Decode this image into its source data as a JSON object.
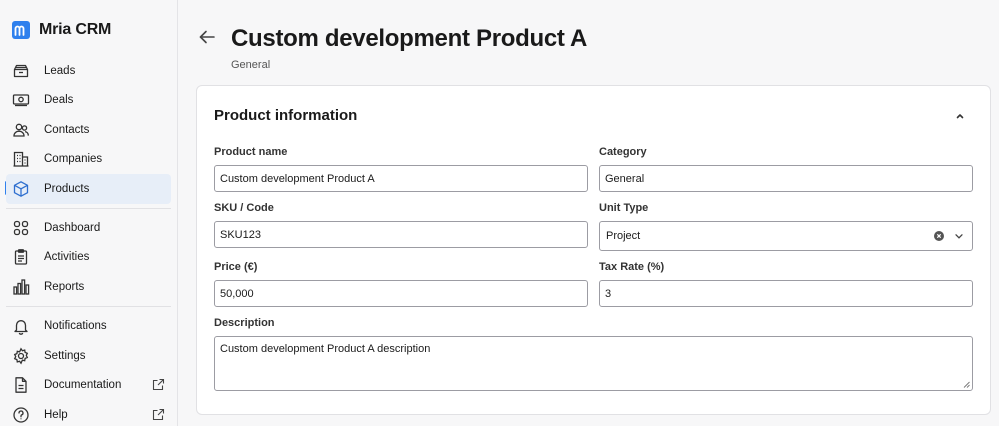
{
  "brand": {
    "name": "Mria CRM",
    "logo_letter": "m",
    "accent": "#2f80ed"
  },
  "sidebar": {
    "items": [
      {
        "label": "Leads",
        "icon": "tray-icon"
      },
      {
        "label": "Deals",
        "icon": "banknote-icon"
      },
      {
        "label": "Contacts",
        "icon": "people-icon"
      },
      {
        "label": "Companies",
        "icon": "building-icon"
      },
      {
        "label": "Products",
        "icon": "cube-icon",
        "active": true
      },
      {
        "label": "Dashboard",
        "icon": "grid-icon"
      },
      {
        "label": "Activities",
        "icon": "clipboard-icon"
      },
      {
        "label": "Reports",
        "icon": "bar-chart-icon"
      },
      {
        "label": "Notifications",
        "icon": "bell-icon"
      },
      {
        "label": "Settings",
        "icon": "gear-icon"
      },
      {
        "label": "Documentation",
        "icon": "document-icon",
        "external": true
      },
      {
        "label": "Help",
        "icon": "help-circle-icon",
        "external": true
      }
    ]
  },
  "header": {
    "title": "Custom development Product A",
    "subtitle": "General"
  },
  "card": {
    "title": "Product information",
    "fields": {
      "product_name": {
        "label": "Product name",
        "value": "Custom development Product A"
      },
      "category": {
        "label": "Category",
        "value": "General"
      },
      "sku": {
        "label": "SKU / Code",
        "value": "SKU123"
      },
      "unit_type": {
        "label": "Unit Type",
        "value": "Project"
      },
      "price": {
        "label": "Price (€)",
        "value": "50,000"
      },
      "tax_rate": {
        "label": "Tax Rate (%)",
        "value": "3"
      },
      "description": {
        "label": "Description",
        "value": "Custom development Product A description"
      }
    }
  }
}
